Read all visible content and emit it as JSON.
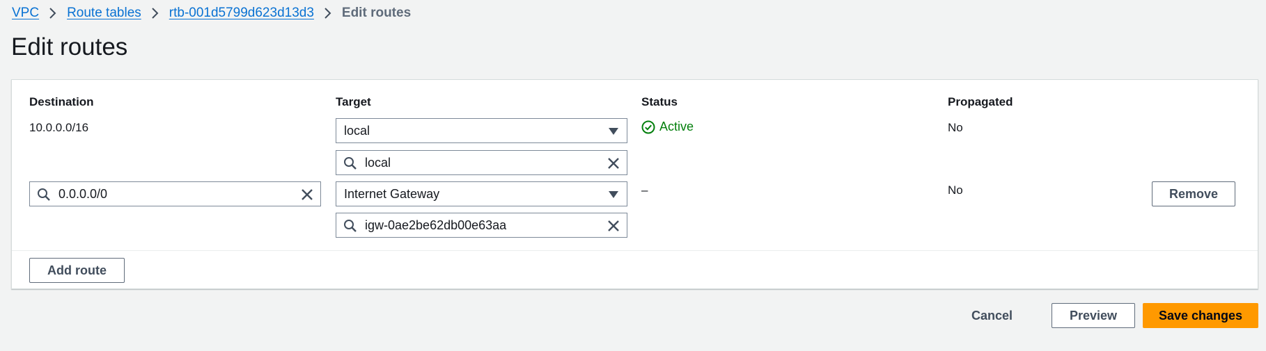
{
  "breadcrumb": {
    "items": [
      {
        "label": "VPC"
      },
      {
        "label": "Route tables"
      },
      {
        "label": "rtb-001d5799d623d13d3"
      }
    ],
    "current": "Edit routes"
  },
  "page": {
    "title": "Edit routes"
  },
  "table": {
    "headers": {
      "destination": "Destination",
      "target": "Target",
      "status": "Status",
      "propagated": "Propagated"
    },
    "rows": [
      {
        "destination": "10.0.0.0/16",
        "target_type": "local",
        "target_search_value": "local",
        "status": "Active",
        "propagated": "No"
      },
      {
        "destination_input_value": "0.0.0.0/0",
        "target_type": "Internet Gateway",
        "target_search_value": "igw-0ae2be62db00e63aa",
        "status": "–",
        "propagated": "No",
        "remove_label": "Remove"
      }
    ]
  },
  "panel": {
    "add_route_label": "Add route"
  },
  "actions": {
    "cancel_label": "Cancel",
    "preview_label": "Preview",
    "save_label": "Save changes"
  },
  "colors": {
    "link": "#0972d3",
    "status_active": "#037f0c",
    "primary_button": "#ff9900",
    "background": "#f2f3f3"
  },
  "icons": {
    "breadcrumb_separator": "chevron-right-icon",
    "search": "search-icon",
    "clear": "close-icon",
    "dropdown": "caret-down-icon",
    "status": "check-circle-icon"
  }
}
